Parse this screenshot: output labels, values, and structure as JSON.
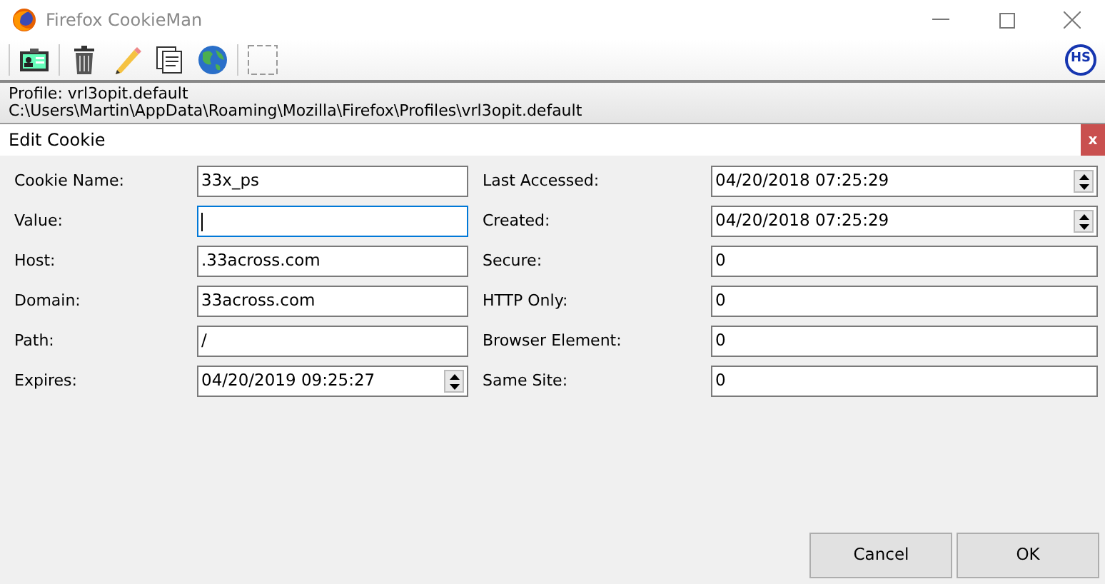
{
  "window": {
    "title": "Firefox CookieMan"
  },
  "toolbar": {
    "buttons": [
      {
        "kind": "card"
      },
      {
        "kind": "trash"
      },
      {
        "kind": "pencil"
      },
      {
        "kind": "copy"
      },
      {
        "kind": "globe"
      },
      {
        "kind": "blank"
      }
    ],
    "badge": "HS"
  },
  "profile": {
    "lines": [
      "Profile: vrl3opit.default",
      "C:\\Users\\Martin\\AppData\\Roaming\\Mozilla\\Firefox\\Profiles\\vrl3opit.default"
    ]
  },
  "dialog": {
    "title": "Edit Cookie",
    "close": "x",
    "left_fields": [
      {
        "label": "Cookie Name:",
        "kind": "text",
        "value": "33x_ps",
        "focused": false
      },
      {
        "label": "Value:",
        "kind": "text",
        "focused": true
      },
      {
        "label": "Host:",
        "kind": "text",
        "value": ".33across.com",
        "focused": false
      },
      {
        "label": "Domain:",
        "kind": "text",
        "value": "33across.com",
        "focused": false
      },
      {
        "label": "Path:",
        "kind": "text",
        "value": "/",
        "focused": false
      },
      {
        "label": "Expires:",
        "kind": "datetime",
        "value": "04/20/2019 09:25:27",
        "focused": false
      }
    ],
    "right_fields": [
      {
        "label": "Last Accessed:",
        "kind": "datetime",
        "value": "04/20/2018 07:25:29",
        "focused": false
      },
      {
        "label": "Created:",
        "kind": "datetime",
        "value": "04/20/2018 07:25:29",
        "focused": false
      },
      {
        "label": "Secure:",
        "kind": "text",
        "value": "0",
        "focused": false
      },
      {
        "label": "HTTP Only:",
        "kind": "text",
        "value": "0",
        "focused": false
      },
      {
        "label": "Browser Element:",
        "kind": "text",
        "value": "0",
        "focused": false
      },
      {
        "label": "Same Site:",
        "kind": "text",
        "value": "0",
        "focused": false
      }
    ],
    "buttons": [
      "Cancel",
      "OK"
    ]
  }
}
